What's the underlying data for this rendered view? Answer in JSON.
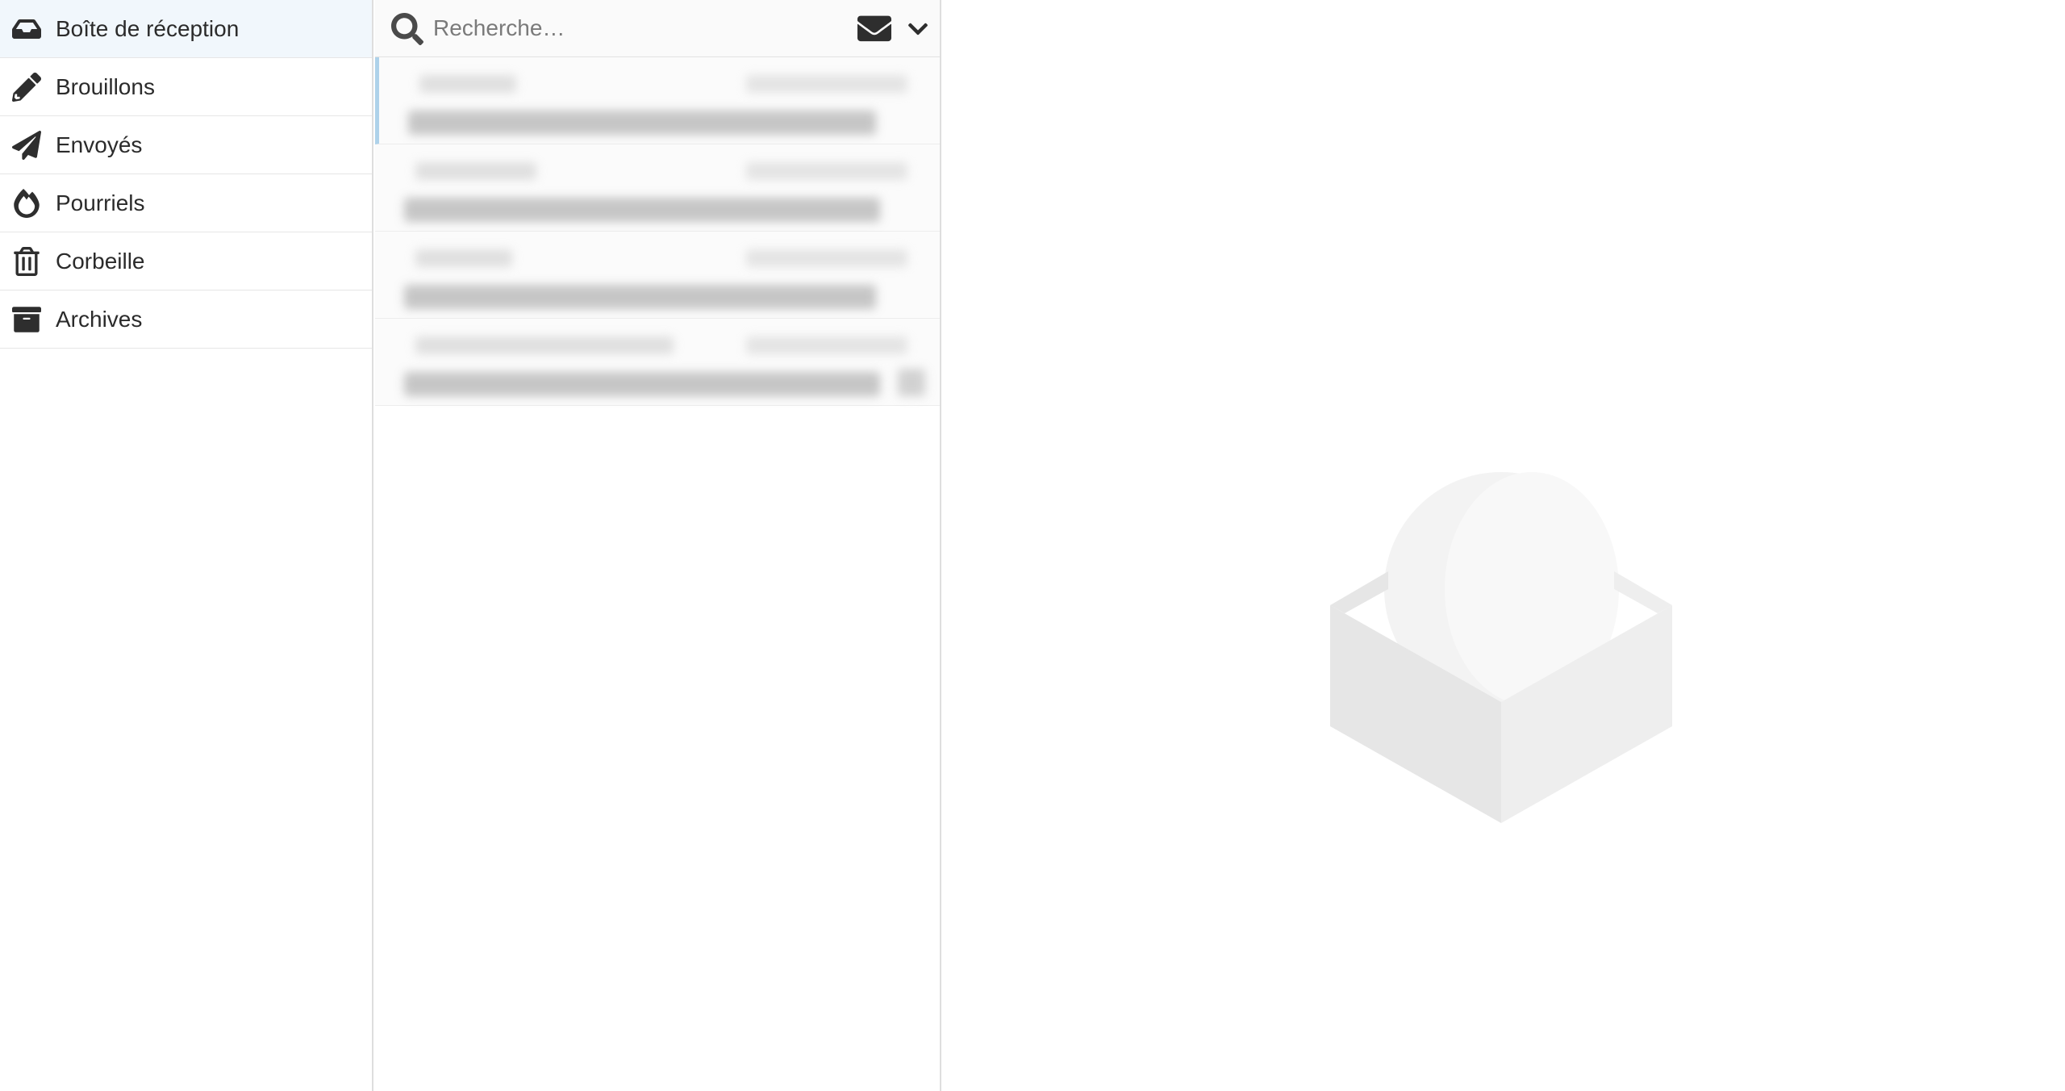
{
  "sidebar": {
    "items": [
      {
        "label": "Boîte de réception",
        "icon": "inbox-icon",
        "active": true
      },
      {
        "label": "Brouillons",
        "icon": "pencil-icon",
        "active": false
      },
      {
        "label": "Envoyés",
        "icon": "paper-plane-icon",
        "active": false
      },
      {
        "label": "Pourriels",
        "icon": "fire-icon",
        "active": false
      },
      {
        "label": "Corbeille",
        "icon": "trash-icon",
        "active": false
      },
      {
        "label": "Archives",
        "icon": "archive-box-icon",
        "active": false
      }
    ]
  },
  "search": {
    "placeholder": "Recherche…"
  },
  "colors": {
    "active_folder_bg": "#f1f7fc",
    "selected_message_marker": "#aed2ea",
    "icon": "#2e2e2e"
  }
}
